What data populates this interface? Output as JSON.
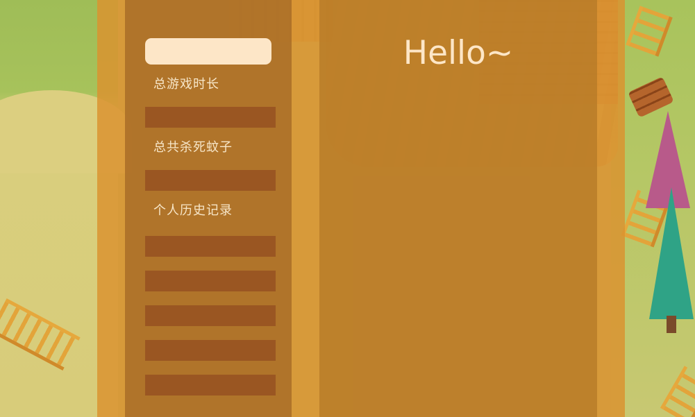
{
  "colors": {
    "panel_overlay": "#DA9230",
    "sidebar": "#AD7129",
    "main_panel": "#B77A28",
    "value_bar": "#9A5622",
    "name_field": "#FDE6C7",
    "text": "#F7E6C8"
  },
  "greeting": "Hello~",
  "sidebar": {
    "name_value": "",
    "stats": [
      {
        "label": "总游戏时长",
        "value": ""
      },
      {
        "label": "总共杀死蚊子",
        "value": ""
      }
    ],
    "history": {
      "label": "个人历史记录",
      "records": [
        "",
        "",
        "",
        "",
        ""
      ]
    }
  }
}
